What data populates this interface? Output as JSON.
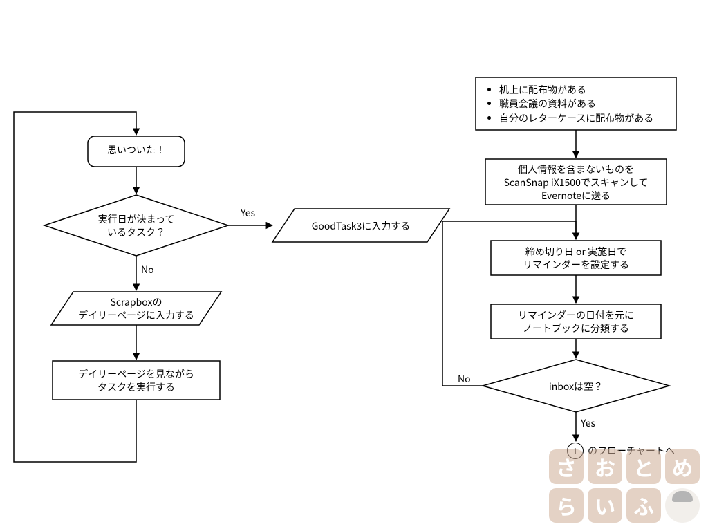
{
  "left": {
    "start": "思いついた！",
    "decision": "実行日が決まって\nいるタスク？",
    "yesBranch": "GoodTask3に入力する",
    "noBranch": "Scrapboxの\nデイリーページに入力する",
    "execute": "デイリーページを見ながら\nタスクを実行する",
    "labels": {
      "yes": "Yes",
      "no": "No"
    }
  },
  "right": {
    "sources": [
      "机上に配布物がある",
      "職員会議の資料がある",
      "自分のレターケースに配布物がある"
    ],
    "scan": "個人情報を含まないものを\nScanSnap iX1500でスキャンして\nEvernoteに送る",
    "setReminder": "締め切り日 or 実施日で\nリマインダーを設定する",
    "classify": "リマインダーの日付を元に\nノートブックに分類する",
    "inboxEmpty": "inboxは空？",
    "labels": {
      "yes": "Yes",
      "no": "No"
    },
    "goto": {
      "n": "1",
      "text": "のフローチャートへ"
    }
  },
  "watermark": [
    "さ",
    "お",
    "と",
    "め",
    "ら",
    "い",
    "ふ"
  ]
}
